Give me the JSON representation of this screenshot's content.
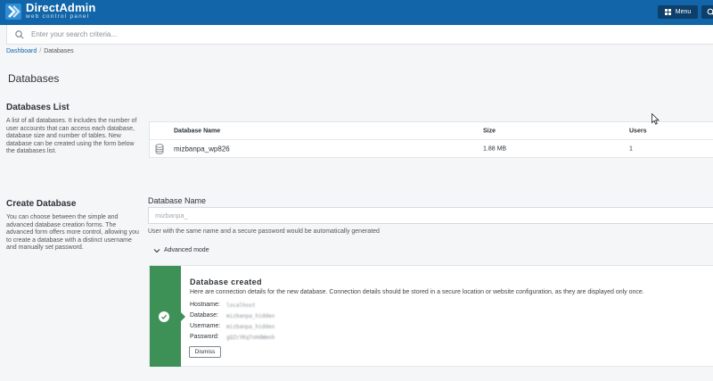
{
  "header": {
    "brand": "DirectAdmin",
    "tagline": "web control panel",
    "menu_label": "Menu",
    "brand_color": "#1165a8",
    "dark_button_color": "#0d3f6a"
  },
  "search": {
    "placeholder": "Enter your search criteria..."
  },
  "breadcrumb": {
    "items": [
      "Dashboard",
      "Databases"
    ],
    "separator": "/"
  },
  "page_title": "Databases",
  "databases_list": {
    "title": "Databases List",
    "description": "A list of all databases. It includes the number of user accounts that can access each database, database size and number of tables. New database can be created using the form below the databases list.",
    "columns": [
      "Database Name",
      "Size",
      "Users"
    ],
    "rows": [
      {
        "name": "mizbanpa_wp826",
        "size": "1.88 MB",
        "users": "1"
      }
    ]
  },
  "create_database": {
    "title": "Create Database",
    "description": "You can choose between the simple and advanced database creation forms. The advanced form offers more control, allowing you to create a database with a distinct username and manually set password.",
    "field_label": "Database Name",
    "field_placeholder": "mizbanpa_",
    "field_hint": "User with the same name and a secure password would be automatically generated",
    "advanced_toggle": "Advanced mode"
  },
  "success_alert": {
    "title": "Database created",
    "message": "Here are connection details for the new database. Connection details should be stored in a secure location or website configuration, as they are displayed only once.",
    "details": [
      {
        "label": "Hostname:",
        "value": "localhost"
      },
      {
        "label": "Database:",
        "value": "mizbanpa_hidden"
      },
      {
        "label": "Username:",
        "value": "mizbanpa_hidden"
      },
      {
        "label": "Password:",
        "value": "gQZcYKqTnHdWmnh"
      }
    ],
    "dismiss_label": "Dismiss",
    "accent_color": "#3d9157"
  }
}
